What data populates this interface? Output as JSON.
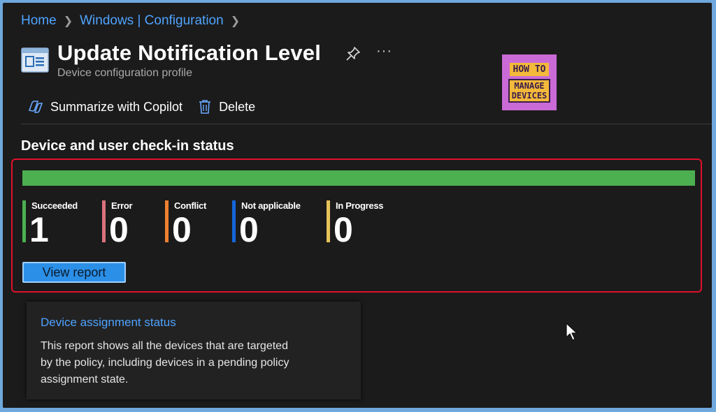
{
  "breadcrumb": {
    "items": [
      "Home",
      "Windows | Configuration"
    ]
  },
  "header": {
    "title": "Update Notification Level",
    "subtitle": "Device configuration profile",
    "icons": {
      "profile": "profile-list-icon",
      "pin": "pin-icon",
      "more": "more-icon"
    }
  },
  "logo": {
    "line1": "HOW TO",
    "line2": "MANAGE",
    "line3": "DEVICES"
  },
  "toolbar": {
    "copilot_label": "Summarize with Copilot",
    "delete_label": "Delete"
  },
  "checkin": {
    "title": "Device and user check-in status",
    "progress": {
      "succeeded_fraction": 1.0
    },
    "stats": [
      {
        "label": "Succeeded",
        "value": "1",
        "color": "#4caf50"
      },
      {
        "label": "Error",
        "value": "0",
        "color": "#d9737d"
      },
      {
        "label": "Conflict",
        "value": "0",
        "color": "#f08030"
      },
      {
        "label": "Not applicable",
        "value": "0",
        "color": "#1565d8"
      },
      {
        "label": "In Progress",
        "value": "0",
        "color": "#e6c25a"
      }
    ],
    "view_report_label": "View report"
  },
  "assignment_card": {
    "title": "Device assignment status",
    "description": "This report shows all the devices that are targeted by the policy, including devices in a pending policy assignment state."
  },
  "colors": {
    "accent": "#4ea3ff",
    "highlight": "#e0102a",
    "success": "#4caf50"
  }
}
